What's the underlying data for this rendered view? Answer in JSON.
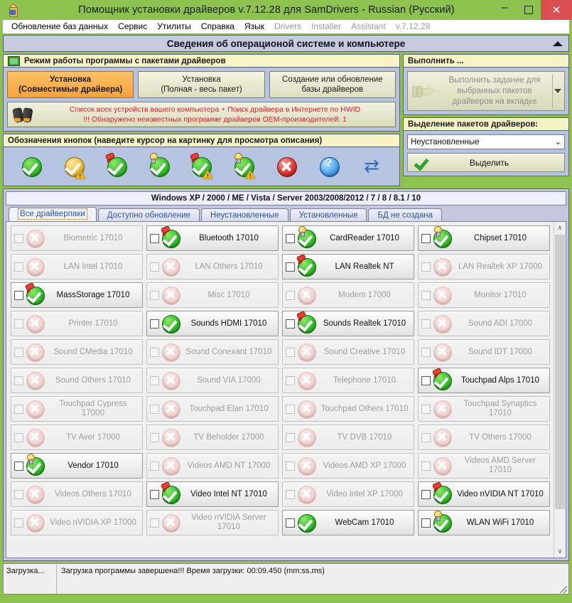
{
  "window": {
    "title": "Помощник установки драйверов v.7.12.28 для SamDrivers - Russian (Русский)",
    "app_icon": "user-icon",
    "minimize": "–",
    "maximize": "□",
    "close": "✕",
    "titlebar_color": "#8dc24f",
    "close_color": "#d94f4f"
  },
  "menubar": {
    "items": [
      {
        "label": "Обновление баз данных",
        "dim": false
      },
      {
        "label": "Сервис",
        "dim": false
      },
      {
        "label": "Утилиты",
        "dim": false
      },
      {
        "label": "Справка",
        "dim": false
      },
      {
        "label": "Язык",
        "dim": false
      },
      {
        "label": "Drivers",
        "dim": true
      },
      {
        "label": "Installer",
        "dim": true
      },
      {
        "label": "Assistant",
        "dim": true
      },
      {
        "label": "v.7.12.28",
        "dim": true
      }
    ]
  },
  "sysinfo": {
    "title": "Сведения об операционой системе и компьютере",
    "collapse_icon": "triangle-up-icon"
  },
  "mode_section": {
    "caption": "Режим работы программы с пакетами драйверов",
    "caption_icon": "chip-icon",
    "buttons": [
      {
        "line1": "Установка",
        "line2": "(Совместимые драйвера)",
        "active": true
      },
      {
        "line1": "Установка",
        "line2": "(Полная - весь пакет)",
        "active": false
      },
      {
        "line1": "Создание или обновление",
        "line2": "базы драйверов",
        "active": false
      }
    ],
    "hwid_icon": "binoculars-icon",
    "hwid_line1": "Список всех устройств вашего компьютера + Поиск драйвера в Интернете по HWID",
    "hwid_line2": "!!! Обнаружено неизвестных программе драйверов OEM-производителей: 1",
    "hwid_color": "#d8232a"
  },
  "legend": {
    "caption": "Обозначения кнопок (наведите курсор на картинку для просмотра описания)",
    "icons": [
      {
        "name": "green-check-icon",
        "disc": "green",
        "mark": "check",
        "badges": []
      },
      {
        "name": "gold-check-warning-icon",
        "disc": "gold",
        "mark": "check",
        "badges": [
          "warn"
        ]
      },
      {
        "name": "green-check-pin-icon",
        "disc": "green",
        "mark": "check",
        "badges": [
          "pin"
        ]
      },
      {
        "name": "green-check-bulb-icon",
        "disc": "green",
        "mark": "check",
        "badges": [
          "bulb"
        ]
      },
      {
        "name": "green-check-pin-warning-icon",
        "disc": "green",
        "mark": "check",
        "badges": [
          "pin",
          "warn"
        ]
      },
      {
        "name": "green-check-bulb-warning-icon",
        "disc": "green",
        "mark": "check",
        "badges": [
          "bulb",
          "warn"
        ]
      },
      {
        "name": "red-cross-icon",
        "disc": "red",
        "mark": "x",
        "badges": []
      },
      {
        "name": "blue-question-icon",
        "disc": "blue",
        "mark": "question",
        "badges": []
      },
      {
        "name": "refresh-arrows-icon",
        "disc": "none",
        "mark": "refresh",
        "badges": []
      }
    ]
  },
  "execute_section": {
    "caption": "Выполнить ...",
    "button_text": "Выполнить задание для выбранных пакетов драйверов на вкладке",
    "button_icon": "arrow-right-icon",
    "dropdown_icon": "caret-down-icon",
    "enabled": false
  },
  "selection_section": {
    "caption": "Выделение пакетов драйверов:",
    "combo_value": "Неустановленные",
    "combo_icon": "chevron-down-icon",
    "button_label": "Выделить",
    "button_icon": "green-check-icon"
  },
  "os_bar": {
    "text": "Windows XP / 2000 / ME / Vista / Server 2003/2008/2012 / 7 / 8 / 8.1 / 10"
  },
  "tabs": [
    {
      "label": "Все драйверпаки",
      "active": true
    },
    {
      "label": "Доступно обновление",
      "active": false
    },
    {
      "label": "Неустановленные",
      "active": false
    },
    {
      "label": "Установленные",
      "active": false
    },
    {
      "label": "БД не создана",
      "active": false
    }
  ],
  "scrollbar": {
    "up_icon": "chevron-up-icon",
    "down_icon": "chevron-down-icon"
  },
  "packages": [
    {
      "name": "Biometric 17010",
      "enabled": false,
      "checked": false,
      "disc": "red",
      "mark": "x",
      "badges": []
    },
    {
      "name": "Bluetooth 17010",
      "enabled": true,
      "checked": false,
      "disc": "green",
      "mark": "check",
      "badges": [
        "pin"
      ]
    },
    {
      "name": "CardReader 17010",
      "enabled": true,
      "checked": false,
      "disc": "green",
      "mark": "check",
      "badges": [
        "bulb"
      ]
    },
    {
      "name": "Chipset 17010",
      "enabled": true,
      "checked": false,
      "disc": "green",
      "mark": "check",
      "badges": [
        "bulb"
      ]
    },
    {
      "name": "LAN Intel 17010",
      "enabled": false,
      "checked": false,
      "disc": "red",
      "mark": "x",
      "badges": []
    },
    {
      "name": "LAN Others 17010",
      "enabled": false,
      "checked": false,
      "disc": "red",
      "mark": "x",
      "badges": []
    },
    {
      "name": "LAN Realtek NT",
      "enabled": true,
      "checked": false,
      "disc": "green",
      "mark": "check",
      "badges": [
        "pin"
      ]
    },
    {
      "name": "LAN Realtek XP 17000",
      "enabled": false,
      "checked": false,
      "disc": "red",
      "mark": "x",
      "badges": []
    },
    {
      "name": "MassStorage 17010",
      "enabled": true,
      "checked": false,
      "disc": "green",
      "mark": "check",
      "badges": [
        "pin"
      ]
    },
    {
      "name": "Misc 17010",
      "enabled": false,
      "checked": false,
      "disc": "red",
      "mark": "x",
      "badges": []
    },
    {
      "name": "Modem 17000",
      "enabled": false,
      "checked": false,
      "disc": "red",
      "mark": "x",
      "badges": []
    },
    {
      "name": "Monitor 17010",
      "enabled": false,
      "checked": false,
      "disc": "red",
      "mark": "x",
      "badges": []
    },
    {
      "name": "Printer 17010",
      "enabled": false,
      "checked": false,
      "disc": "red",
      "mark": "x",
      "badges": []
    },
    {
      "name": "Sounds HDMI 17010",
      "enabled": true,
      "checked": false,
      "disc": "green",
      "mark": "check",
      "badges": []
    },
    {
      "name": "Sounds Realtek 17010",
      "enabled": true,
      "checked": false,
      "disc": "green",
      "mark": "check",
      "badges": [
        "pin"
      ]
    },
    {
      "name": "Sound ADI 17000",
      "enabled": false,
      "checked": false,
      "disc": "red",
      "mark": "x",
      "badges": []
    },
    {
      "name": "Sound CMedia 17010",
      "enabled": false,
      "checked": false,
      "disc": "red",
      "mark": "x",
      "badges": []
    },
    {
      "name": "Sound Conexant 17010",
      "enabled": false,
      "checked": false,
      "disc": "red",
      "mark": "x",
      "badges": []
    },
    {
      "name": "Sound Creative 17010",
      "enabled": false,
      "checked": false,
      "disc": "red",
      "mark": "x",
      "badges": []
    },
    {
      "name": "Sound IDT 17000",
      "enabled": false,
      "checked": false,
      "disc": "red",
      "mark": "x",
      "badges": []
    },
    {
      "name": "Sound Others 17010",
      "enabled": false,
      "checked": false,
      "disc": "red",
      "mark": "x",
      "badges": []
    },
    {
      "name": "Sound VIA 17000",
      "enabled": false,
      "checked": false,
      "disc": "red",
      "mark": "x",
      "badges": []
    },
    {
      "name": "Telephone 17010",
      "enabled": false,
      "checked": false,
      "disc": "red",
      "mark": "x",
      "badges": []
    },
    {
      "name": "Touchpad Alps 17010",
      "enabled": true,
      "checked": false,
      "disc": "green",
      "mark": "check",
      "badges": [
        "pin"
      ]
    },
    {
      "name": "Touchpad Cypress 17000",
      "enabled": false,
      "checked": false,
      "disc": "red",
      "mark": "x",
      "badges": []
    },
    {
      "name": "Touchpad Elan 17010",
      "enabled": false,
      "checked": false,
      "disc": "red",
      "mark": "x",
      "badges": []
    },
    {
      "name": "Touchpad Others 17010",
      "enabled": false,
      "checked": false,
      "disc": "red",
      "mark": "x",
      "badges": []
    },
    {
      "name": "Touchpad Synaptics 17010",
      "enabled": false,
      "checked": false,
      "disc": "red",
      "mark": "x",
      "badges": []
    },
    {
      "name": "TV Aver 17000",
      "enabled": false,
      "checked": false,
      "disc": "red",
      "mark": "x",
      "badges": []
    },
    {
      "name": "TV Beholder 17000",
      "enabled": false,
      "checked": false,
      "disc": "red",
      "mark": "x",
      "badges": []
    },
    {
      "name": "TV DVB 17010",
      "enabled": false,
      "checked": false,
      "disc": "red",
      "mark": "x",
      "badges": []
    },
    {
      "name": "TV Others 17000",
      "enabled": false,
      "checked": false,
      "disc": "red",
      "mark": "x",
      "badges": []
    },
    {
      "name": "Vendor 17010",
      "enabled": true,
      "checked": false,
      "disc": "green",
      "mark": "check",
      "badges": [
        "bulb"
      ]
    },
    {
      "name": "Videos AMD NT 17000",
      "enabled": false,
      "checked": false,
      "disc": "red",
      "mark": "x",
      "badges": []
    },
    {
      "name": "Videos AMD XP 17000",
      "enabled": false,
      "checked": false,
      "disc": "red",
      "mark": "x",
      "badges": []
    },
    {
      "name": "Videos AMD Server 17010",
      "enabled": false,
      "checked": false,
      "disc": "red",
      "mark": "x",
      "badges": []
    },
    {
      "name": "Videos Others 17010",
      "enabled": false,
      "checked": false,
      "disc": "red",
      "mark": "x",
      "badges": []
    },
    {
      "name": "Video Intel NT 17010",
      "enabled": true,
      "checked": false,
      "disc": "green",
      "mark": "check",
      "badges": [
        "pin"
      ]
    },
    {
      "name": "Video Intel XP 17000",
      "enabled": false,
      "checked": false,
      "disc": "red",
      "mark": "x",
      "badges": []
    },
    {
      "name": "Video nVIDIA NT 17010",
      "enabled": true,
      "checked": false,
      "disc": "green",
      "mark": "check",
      "badges": [
        "pin"
      ]
    },
    {
      "name": "Video nVIDIA XP 17000",
      "enabled": false,
      "checked": false,
      "disc": "red",
      "mark": "x",
      "badges": []
    },
    {
      "name": "Video nVIDIA Server 17010",
      "enabled": false,
      "checked": false,
      "disc": "red",
      "mark": "x",
      "badges": []
    },
    {
      "name": "WebCam 17010",
      "enabled": true,
      "checked": false,
      "disc": "green",
      "mark": "check",
      "badges": []
    },
    {
      "name": "WLAN WiFi 17010",
      "enabled": true,
      "checked": false,
      "disc": "green",
      "mark": "check",
      "badges": [
        "bulb"
      ]
    }
  ],
  "statusbar": {
    "left": "Загрузка...",
    "right": "Загрузка программы завершена!!! Время загрузки: 00:09.450 (mm:ss.ms)"
  }
}
